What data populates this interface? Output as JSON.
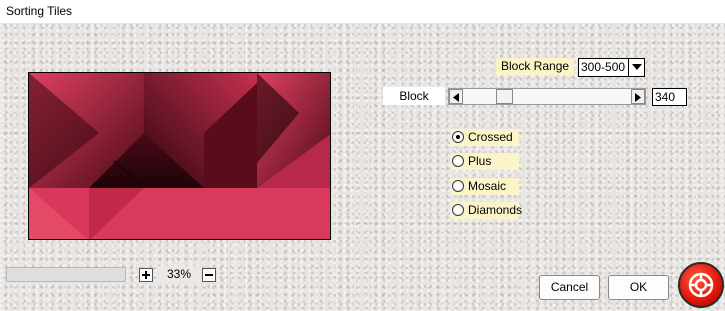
{
  "window": {
    "title": "Sorting Tiles"
  },
  "controls": {
    "block_range": {
      "label": "Block Range",
      "value": "300-500"
    },
    "block": {
      "label": "Block",
      "value": "340"
    },
    "pattern": {
      "options": [
        "Crossed",
        "Plus",
        "Mosaic",
        "Diamonds"
      ],
      "selected": "Crossed"
    }
  },
  "footer": {
    "zoom_plus": "+",
    "zoom_value": "33%",
    "zoom_minus": "−",
    "cancel_label": "Cancel",
    "ok_label": "OK"
  },
  "colors": {
    "tile_light": "#d9385a",
    "tile_dark": "#3a0712",
    "label_bg": "#fbf4c8",
    "help_button": "#e0140a"
  },
  "icons": {
    "dropdown": "chevron-down-icon",
    "slider_left": "triangle-left-icon",
    "slider_right": "triangle-right-icon",
    "help": "lifebuoy-icon"
  }
}
